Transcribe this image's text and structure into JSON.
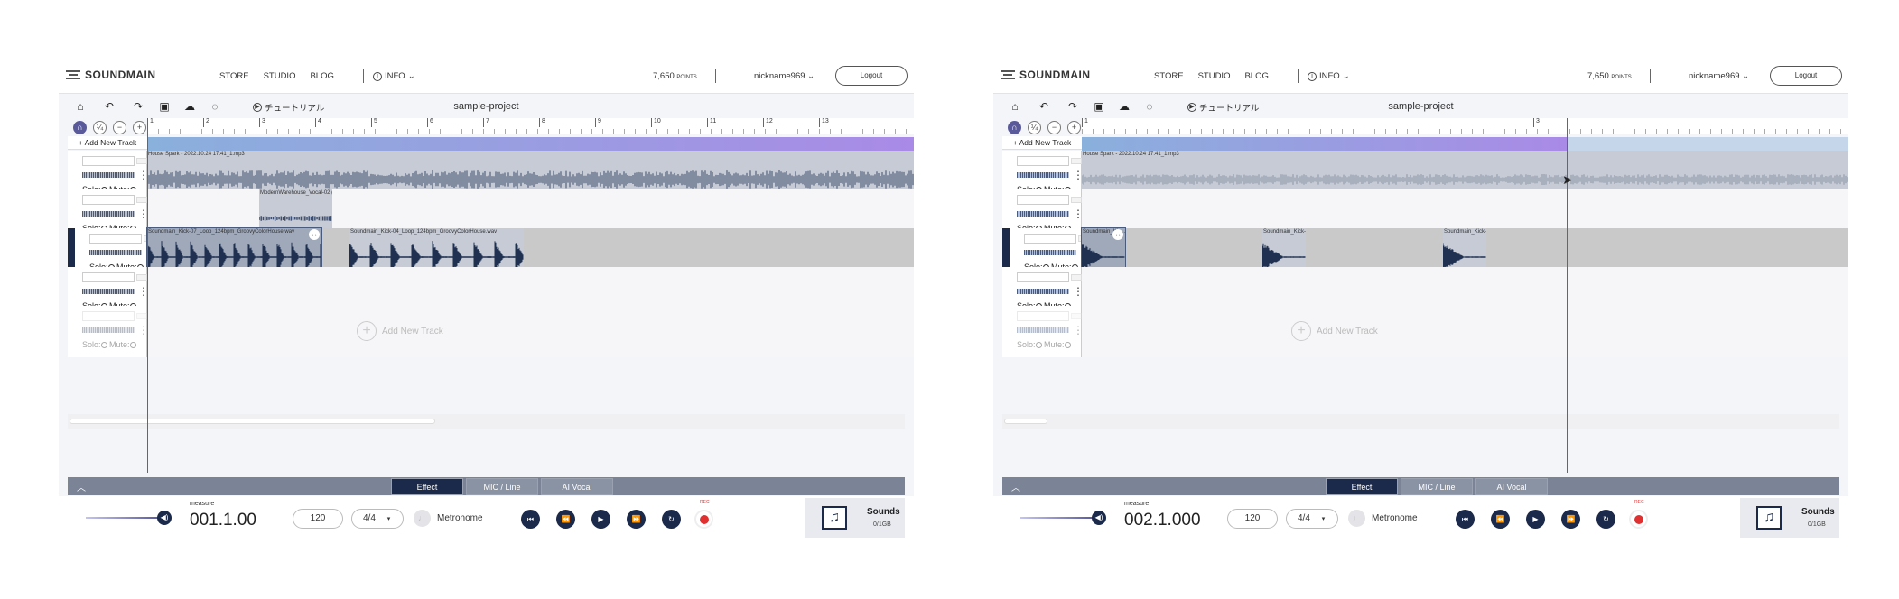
{
  "nav": {
    "brand": "SOUNDMAIN",
    "links": [
      "STORE",
      "STUDIO",
      "BLOG"
    ],
    "info": "INFO",
    "points_value": "7,650",
    "points_unit": "POINTS",
    "user": "nickname969",
    "logout": "Logout"
  },
  "toolbar": {
    "tutorial": "チュートリアル",
    "project": "sample-project",
    "add_track": "+ Add New Track"
  },
  "tracks": {
    "solo_mute": "Solo: Mute:",
    "solo": "Solo:",
    "mute": "Mute:",
    "add_new_track": "Add New Track"
  },
  "left": {
    "ruler": [
      "1",
      "2",
      "3",
      "4",
      "5",
      "6",
      "7",
      "8",
      "9",
      "10",
      "11",
      "12",
      "13"
    ],
    "clips": [
      {
        "name": "House Spark - 2022.10.24 17.41_1.mp3"
      },
      {
        "name": "ModernWarehouse_Vocal-02 (fr..."
      },
      {
        "name": "Soundmain_Kick-07_Loop_124bpm_GroovyColorHouse.wav"
      },
      {
        "name": "Soundmain_Kick-04_Loop_124bpm_GroovyColorHouse.wav"
      }
    ],
    "measure_label": "measure",
    "measure": "001.1.00"
  },
  "right": {
    "ruler": [
      "1",
      "3"
    ],
    "clips": [
      {
        "name": "House Spark - 2022.10.24 17.41_1.mp3"
      },
      {
        "name": "Soundmain_Kic..."
      },
      {
        "name": "Soundmain_Kick-..."
      },
      {
        "name": "Soundmain_Kick-..."
      }
    ],
    "measure_label": "measure",
    "measure": "002.1.000"
  },
  "tabs": [
    "Effect",
    "MIC / Line",
    "AI Vocal"
  ],
  "transport": {
    "bpm": "120",
    "signature": "4/4",
    "metronome": "Metronome",
    "rec_label": "REC"
  },
  "sounds": {
    "title": "Sounds",
    "storage": "0/1GB"
  },
  "colors": {
    "navy": "#1b2a4a",
    "region_start": "#8ab0dc",
    "region_end": "#a98ae6",
    "rec": "#e03030"
  }
}
